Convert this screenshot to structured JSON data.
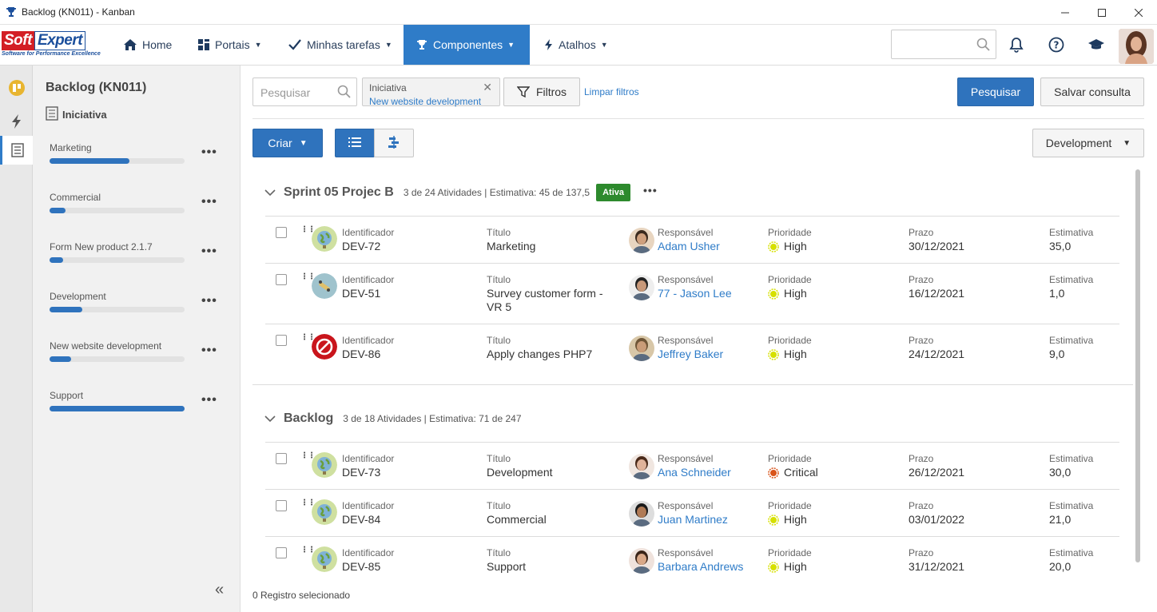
{
  "window": {
    "title": "Backlog (KN011) - Kanban"
  },
  "nav": {
    "logo_soft": "Soft",
    "logo_expert": "Expert",
    "logo_tagline": "Software for Performance Excellence",
    "items": [
      {
        "label": "Home",
        "icon": "home-icon"
      },
      {
        "label": "Portais",
        "icon": "grid-icon"
      },
      {
        "label": "Minhas tarefas",
        "icon": "check-icon"
      },
      {
        "label": "Componentes",
        "icon": "trophy-icon",
        "active": true
      },
      {
        "label": "Atalhos",
        "icon": "bolt-icon"
      }
    ]
  },
  "sidebar": {
    "title": "Backlog (KN011)",
    "subtitle": "Iniciativa",
    "items": [
      {
        "label": "Marketing",
        "progress": 0.59
      },
      {
        "label": "Commercial",
        "progress": 0.12
      },
      {
        "label": "Form New product 2.1.7",
        "progress": 0.1
      },
      {
        "label": "Development",
        "progress": 0.24
      },
      {
        "label": "New website development",
        "progress": 0.16
      },
      {
        "label": "Support",
        "progress": 1.0
      }
    ]
  },
  "toolbar": {
    "search_placeholder": "Pesquisar",
    "chip_label": "Iniciativa",
    "chip_value": "New website development",
    "filters_label": "Filtros",
    "clear_filters": "Limpar filtros",
    "search_button": "Pesquisar",
    "save_button": "Salvar consulta",
    "create_button": "Criar",
    "team_select": "Development"
  },
  "labels": {
    "id": "Identificador",
    "title": "Título",
    "owner": "Responsável",
    "priority": "Prioridade",
    "due": "Prazo",
    "estimate": "Estimativa"
  },
  "sections": [
    {
      "name": "Sprint 05 Projec B",
      "info": "3 de 24 Atividades | Estimativa: 45 de 137,5",
      "badge": "Ativa",
      "rows": [
        {
          "id": "DEV-72",
          "title": "Marketing",
          "owner": "Adam Usher",
          "priority": "High",
          "due": "30/12/2021",
          "estimate": "35,0",
          "type": "globe"
        },
        {
          "id": "DEV-51",
          "title": "Survey customer form - VR 5",
          "owner": "77 - Jason Lee",
          "priority": "High",
          "due": "16/12/2021",
          "estimate": "1,0",
          "type": "bug"
        },
        {
          "id": "DEV-86",
          "title": "Apply changes PHP7",
          "owner": "Jeffrey Baker",
          "priority": "High",
          "due": "24/12/2021",
          "estimate": "9,0",
          "type": "blocked"
        }
      ]
    },
    {
      "name": "Backlog",
      "info": "3 de 18 Atividades | Estimativa: 71 de 247",
      "rows": [
        {
          "id": "DEV-73",
          "title": "Development",
          "owner": "Ana Schneider",
          "priority": "Critical",
          "due": "26/12/2021",
          "estimate": "30,0",
          "type": "globe"
        },
        {
          "id": "DEV-84",
          "title": "Commercial",
          "owner": "Juan Martinez",
          "priority": "High",
          "due": "03/01/2022",
          "estimate": "21,0",
          "type": "globe"
        },
        {
          "id": "DEV-85",
          "title": "Support",
          "owner": "Barbara Andrews",
          "priority": "High",
          "due": "31/12/2021",
          "estimate": "20,0",
          "type": "globe"
        }
      ]
    }
  ],
  "footer": {
    "selected": "0 Registro selecionado"
  },
  "colors": {
    "accent": "#2f7cc8",
    "primary_button": "#2f73bd",
    "badge": "#2d8a2d",
    "high": "#d6e000",
    "critical": "#d9541a"
  }
}
